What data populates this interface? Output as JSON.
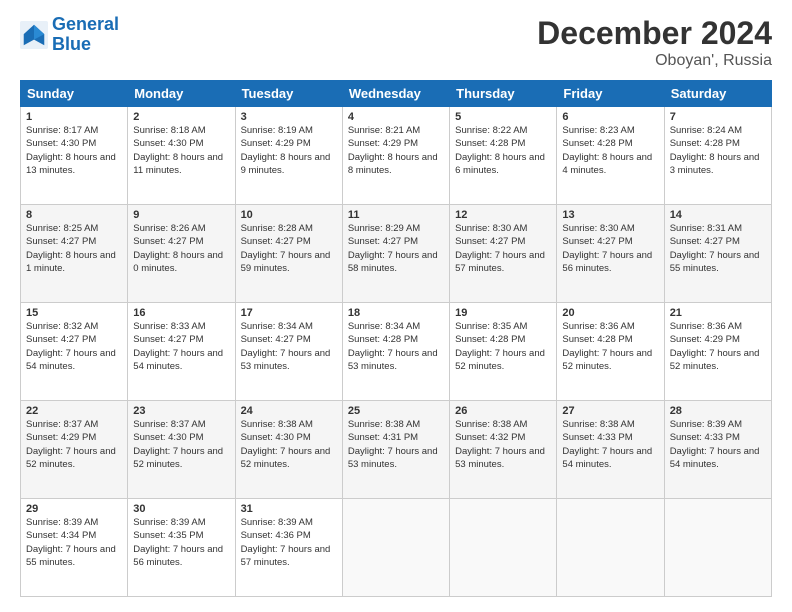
{
  "header": {
    "logo_line1": "General",
    "logo_line2": "Blue",
    "month_title": "December 2024",
    "location": "Oboyan', Russia"
  },
  "weekdays": [
    "Sunday",
    "Monday",
    "Tuesday",
    "Wednesday",
    "Thursday",
    "Friday",
    "Saturday"
  ],
  "weeks": [
    [
      {
        "day": "1",
        "sunrise": "Sunrise: 8:17 AM",
        "sunset": "Sunset: 4:30 PM",
        "daylight": "Daylight: 8 hours and 13 minutes."
      },
      {
        "day": "2",
        "sunrise": "Sunrise: 8:18 AM",
        "sunset": "Sunset: 4:30 PM",
        "daylight": "Daylight: 8 hours and 11 minutes."
      },
      {
        "day": "3",
        "sunrise": "Sunrise: 8:19 AM",
        "sunset": "Sunset: 4:29 PM",
        "daylight": "Daylight: 8 hours and 9 minutes."
      },
      {
        "day": "4",
        "sunrise": "Sunrise: 8:21 AM",
        "sunset": "Sunset: 4:29 PM",
        "daylight": "Daylight: 8 hours and 8 minutes."
      },
      {
        "day": "5",
        "sunrise": "Sunrise: 8:22 AM",
        "sunset": "Sunset: 4:28 PM",
        "daylight": "Daylight: 8 hours and 6 minutes."
      },
      {
        "day": "6",
        "sunrise": "Sunrise: 8:23 AM",
        "sunset": "Sunset: 4:28 PM",
        "daylight": "Daylight: 8 hours and 4 minutes."
      },
      {
        "day": "7",
        "sunrise": "Sunrise: 8:24 AM",
        "sunset": "Sunset: 4:28 PM",
        "daylight": "Daylight: 8 hours and 3 minutes."
      }
    ],
    [
      {
        "day": "8",
        "sunrise": "Sunrise: 8:25 AM",
        "sunset": "Sunset: 4:27 PM",
        "daylight": "Daylight: 8 hours and 1 minute."
      },
      {
        "day": "9",
        "sunrise": "Sunrise: 8:26 AM",
        "sunset": "Sunset: 4:27 PM",
        "daylight": "Daylight: 8 hours and 0 minutes."
      },
      {
        "day": "10",
        "sunrise": "Sunrise: 8:28 AM",
        "sunset": "Sunset: 4:27 PM",
        "daylight": "Daylight: 7 hours and 59 minutes."
      },
      {
        "day": "11",
        "sunrise": "Sunrise: 8:29 AM",
        "sunset": "Sunset: 4:27 PM",
        "daylight": "Daylight: 7 hours and 58 minutes."
      },
      {
        "day": "12",
        "sunrise": "Sunrise: 8:30 AM",
        "sunset": "Sunset: 4:27 PM",
        "daylight": "Daylight: 7 hours and 57 minutes."
      },
      {
        "day": "13",
        "sunrise": "Sunrise: 8:30 AM",
        "sunset": "Sunset: 4:27 PM",
        "daylight": "Daylight: 7 hours and 56 minutes."
      },
      {
        "day": "14",
        "sunrise": "Sunrise: 8:31 AM",
        "sunset": "Sunset: 4:27 PM",
        "daylight": "Daylight: 7 hours and 55 minutes."
      }
    ],
    [
      {
        "day": "15",
        "sunrise": "Sunrise: 8:32 AM",
        "sunset": "Sunset: 4:27 PM",
        "daylight": "Daylight: 7 hours and 54 minutes."
      },
      {
        "day": "16",
        "sunrise": "Sunrise: 8:33 AM",
        "sunset": "Sunset: 4:27 PM",
        "daylight": "Daylight: 7 hours and 54 minutes."
      },
      {
        "day": "17",
        "sunrise": "Sunrise: 8:34 AM",
        "sunset": "Sunset: 4:27 PM",
        "daylight": "Daylight: 7 hours and 53 minutes."
      },
      {
        "day": "18",
        "sunrise": "Sunrise: 8:34 AM",
        "sunset": "Sunset: 4:28 PM",
        "daylight": "Daylight: 7 hours and 53 minutes."
      },
      {
        "day": "19",
        "sunrise": "Sunrise: 8:35 AM",
        "sunset": "Sunset: 4:28 PM",
        "daylight": "Daylight: 7 hours and 52 minutes."
      },
      {
        "day": "20",
        "sunrise": "Sunrise: 8:36 AM",
        "sunset": "Sunset: 4:28 PM",
        "daylight": "Daylight: 7 hours and 52 minutes."
      },
      {
        "day": "21",
        "sunrise": "Sunrise: 8:36 AM",
        "sunset": "Sunset: 4:29 PM",
        "daylight": "Daylight: 7 hours and 52 minutes."
      }
    ],
    [
      {
        "day": "22",
        "sunrise": "Sunrise: 8:37 AM",
        "sunset": "Sunset: 4:29 PM",
        "daylight": "Daylight: 7 hours and 52 minutes."
      },
      {
        "day": "23",
        "sunrise": "Sunrise: 8:37 AM",
        "sunset": "Sunset: 4:30 PM",
        "daylight": "Daylight: 7 hours and 52 minutes."
      },
      {
        "day": "24",
        "sunrise": "Sunrise: 8:38 AM",
        "sunset": "Sunset: 4:30 PM",
        "daylight": "Daylight: 7 hours and 52 minutes."
      },
      {
        "day": "25",
        "sunrise": "Sunrise: 8:38 AM",
        "sunset": "Sunset: 4:31 PM",
        "daylight": "Daylight: 7 hours and 53 minutes."
      },
      {
        "day": "26",
        "sunrise": "Sunrise: 8:38 AM",
        "sunset": "Sunset: 4:32 PM",
        "daylight": "Daylight: 7 hours and 53 minutes."
      },
      {
        "day": "27",
        "sunrise": "Sunrise: 8:38 AM",
        "sunset": "Sunset: 4:33 PM",
        "daylight": "Daylight: 7 hours and 54 minutes."
      },
      {
        "day": "28",
        "sunrise": "Sunrise: 8:39 AM",
        "sunset": "Sunset: 4:33 PM",
        "daylight": "Daylight: 7 hours and 54 minutes."
      }
    ],
    [
      {
        "day": "29",
        "sunrise": "Sunrise: 8:39 AM",
        "sunset": "Sunset: 4:34 PM",
        "daylight": "Daylight: 7 hours and 55 minutes."
      },
      {
        "day": "30",
        "sunrise": "Sunrise: 8:39 AM",
        "sunset": "Sunset: 4:35 PM",
        "daylight": "Daylight: 7 hours and 56 minutes."
      },
      {
        "day": "31",
        "sunrise": "Sunrise: 8:39 AM",
        "sunset": "Sunset: 4:36 PM",
        "daylight": "Daylight: 7 hours and 57 minutes."
      },
      null,
      null,
      null,
      null
    ]
  ]
}
